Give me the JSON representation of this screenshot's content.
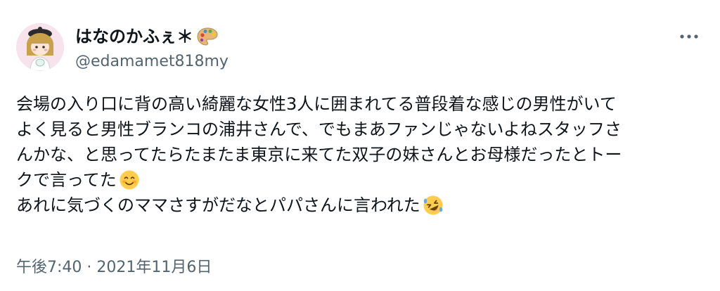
{
  "author": {
    "display_name": "はなのかふぇ＊",
    "handle": "@edamamet818my",
    "avatar_icon": "character-avatar-icon",
    "name_emoji_icon": "artist-palette-icon"
  },
  "menu": {
    "icon": "more-options-icon"
  },
  "tweet": {
    "line_1": "会場の入り口に背の高い綺麗な女性3人に囲まれてる普段着な感じの男性がいて",
    "line_2": "よく見ると男性ブランコの浦井さんで、でもまあファンじゃないよねスタッフさ",
    "line_3": "んかな、と思ってたらたまたま東京に来てた双子の妹さんとお母様だったとトー",
    "line_4": "クで言ってた",
    "line_5": "あれに気づくのママさすがだなとパパさんに言われた",
    "emoji_1": "smiling-face-icon",
    "emoji_2": "rolling-on-floor-laughing-icon"
  },
  "timestamp": "午後7:40 · 2021年11月6日",
  "colors": {
    "text_primary": "#0f1419",
    "text_secondary": "#536471",
    "background": "#ffffff"
  }
}
